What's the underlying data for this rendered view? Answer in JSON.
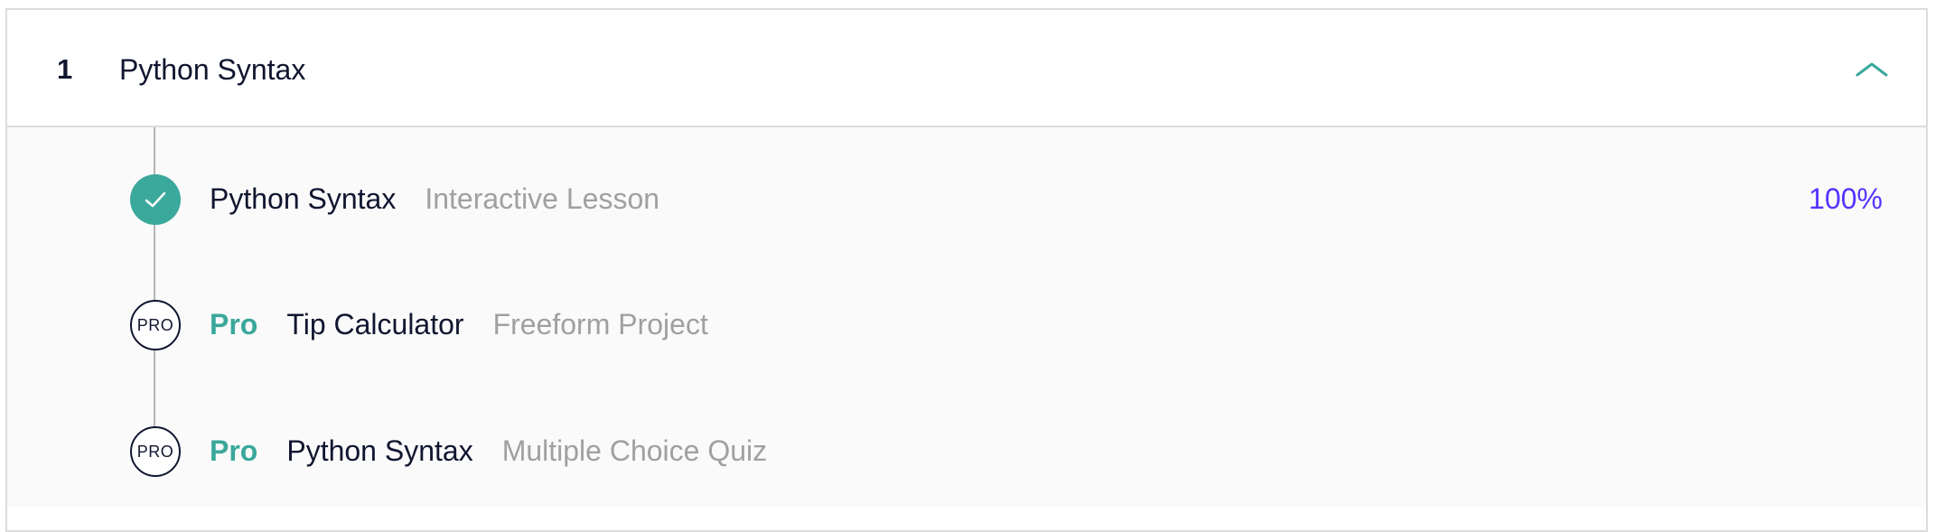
{
  "module": {
    "number": "1",
    "title": "Python Syntax",
    "collapse_icon": "chevron-up-icon",
    "accent_color": "#3aa89b"
  },
  "items": [
    {
      "status": "completed",
      "status_icon": "checkmark-icon",
      "name": "Python Syntax",
      "type": "Interactive Lesson",
      "progress": "100%"
    },
    {
      "status": "pro",
      "badge": "PRO",
      "pro_label": "Pro",
      "name": "Tip Calculator",
      "type": "Freeform Project"
    },
    {
      "status": "pro",
      "badge": "PRO",
      "pro_label": "Pro",
      "name": "Python Syntax",
      "type": "Multiple Choice Quiz"
    }
  ],
  "colors": {
    "progress": "#5533ff",
    "text": "#10162f",
    "muted": "#a0a0a0"
  }
}
